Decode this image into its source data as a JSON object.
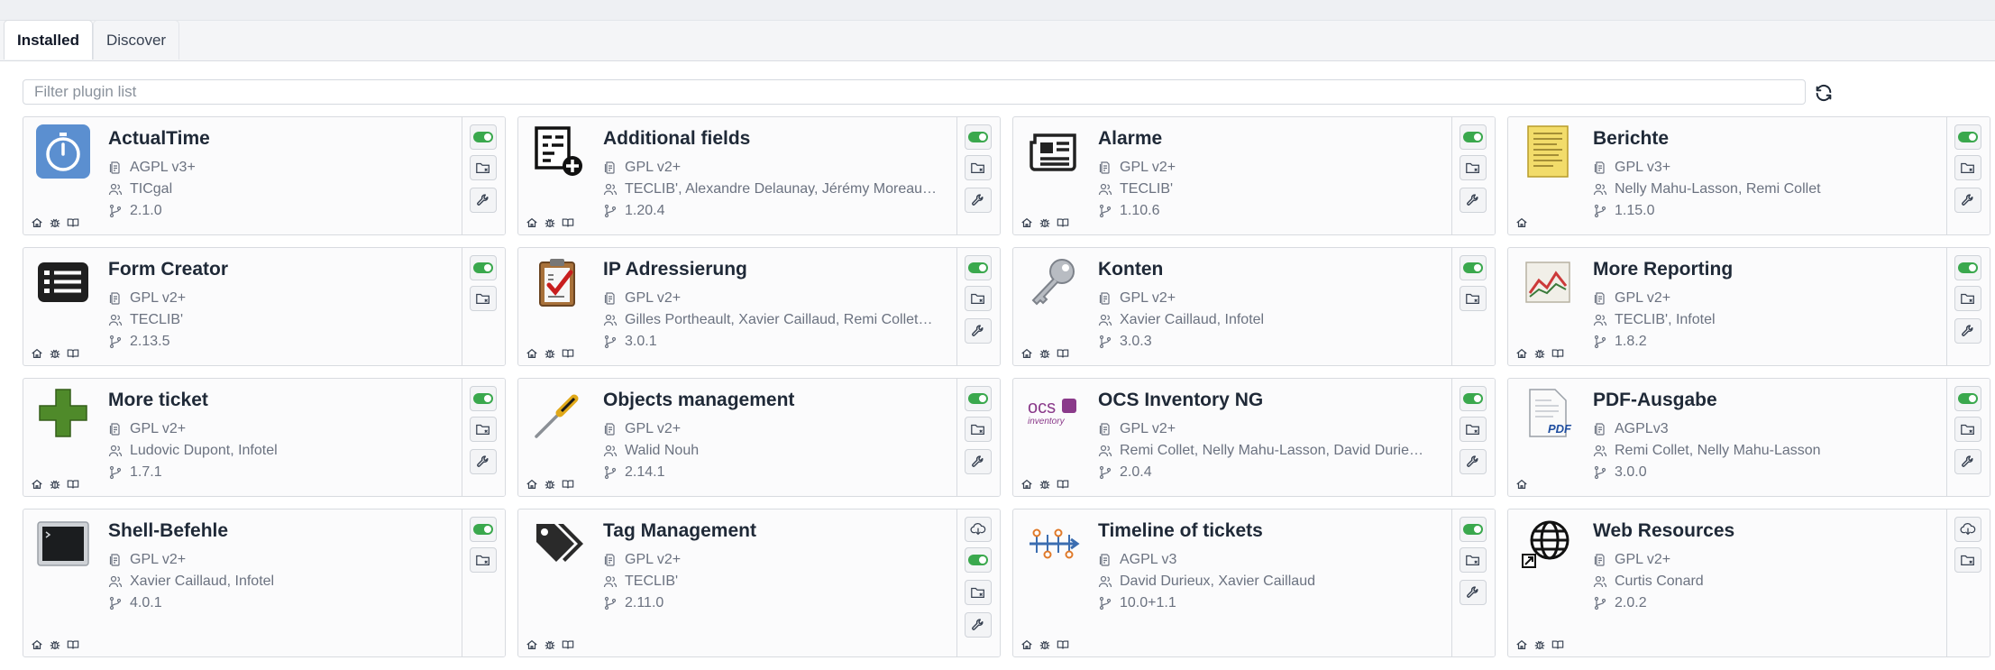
{
  "tabs": [
    {
      "label": "Installed",
      "active": true
    },
    {
      "label": "Discover",
      "active": false
    }
  ],
  "filter": {
    "placeholder": "Filter plugin list"
  },
  "plugins": [
    {
      "name": "ActualTime",
      "license": "AGPL v3+",
      "authors": "TICgal",
      "version": "2.1.0",
      "logo": "stopwatch-icon",
      "links": [
        "home",
        "bug",
        "book"
      ],
      "actions": [
        "toggle",
        "uninstall",
        "configure"
      ]
    },
    {
      "name": "Additional fields",
      "license": "GPL v2+",
      "authors": "TECLIB', Alexandre Delaunay, Jérémy Moreau…",
      "version": "1.20.4",
      "logo": "form-plus-icon",
      "links": [
        "home",
        "bug",
        "book"
      ],
      "actions": [
        "toggle",
        "uninstall",
        "configure"
      ]
    },
    {
      "name": "Alarme",
      "license": "GPL v2+",
      "authors": "TECLIB'",
      "version": "1.10.6",
      "logo": "newspaper-icon",
      "links": [
        "home",
        "bug",
        "book"
      ],
      "actions": [
        "toggle",
        "uninstall",
        "configure"
      ]
    },
    {
      "name": "Berichte",
      "license": "GPL v3+",
      "authors": "Nelly Mahu-Lasson, Remi Collet",
      "version": "1.15.0",
      "logo": "report-paper-icon",
      "links": [
        "home"
      ],
      "actions": [
        "toggle",
        "uninstall",
        "configure"
      ]
    },
    {
      "name": "Form Creator",
      "license": "GPL v2+",
      "authors": "TECLIB'",
      "version": "2.13.5",
      "logo": "list-form-icon",
      "links": [
        "home",
        "bug",
        "book"
      ],
      "actions": [
        "toggle",
        "uninstall"
      ]
    },
    {
      "name": "IP Adressierung",
      "license": "GPL v2+",
      "authors": "Gilles Portheault, Xavier Caillaud, Remi Collet…",
      "version": "3.0.1",
      "logo": "clipboard-check-icon",
      "links": [
        "home",
        "bug",
        "book"
      ],
      "actions": [
        "toggle",
        "uninstall",
        "configure"
      ]
    },
    {
      "name": "Konten",
      "license": "GPL v2+",
      "authors": "Xavier Caillaud, Infotel",
      "version": "3.0.3",
      "logo": "key-icon",
      "links": [
        "home",
        "bug",
        "book"
      ],
      "actions": [
        "toggle",
        "uninstall"
      ]
    },
    {
      "name": "More Reporting",
      "license": "GPL v2+",
      "authors": "TECLIB', Infotel",
      "version": "1.8.2",
      "logo": "line-chart-icon",
      "links": [
        "home",
        "bug",
        "book"
      ],
      "actions": [
        "toggle",
        "uninstall",
        "configure"
      ]
    },
    {
      "name": "More ticket",
      "license": "GPL v2+",
      "authors": "Ludovic Dupont, Infotel",
      "version": "1.7.1",
      "logo": "green-plus-icon",
      "links": [
        "home",
        "bug",
        "book"
      ],
      "actions": [
        "toggle",
        "uninstall",
        "configure"
      ]
    },
    {
      "name": "Objects management",
      "license": "GPL v2+",
      "authors": "Walid Nouh",
      "version": "2.14.1",
      "logo": "screwdriver-icon",
      "links": [
        "home",
        "bug",
        "book"
      ],
      "actions": [
        "toggle",
        "uninstall",
        "configure"
      ]
    },
    {
      "name": "OCS Inventory NG",
      "license": "GPL v2+",
      "authors": "Remi Collet, Nelly Mahu-Lasson, David Durie…",
      "version": "2.0.4",
      "logo": "ocs-logo",
      "logo_text": "ocs",
      "logo_subtext": "inventory",
      "links": [
        "home",
        "bug",
        "book"
      ],
      "actions": [
        "toggle",
        "uninstall",
        "configure"
      ]
    },
    {
      "name": "PDF-Ausgabe",
      "license": "AGPLv3",
      "authors": "Remi Collet, Nelly Mahu-Lasson",
      "version": "3.0.0",
      "logo": "pdf-document-icon",
      "logo_text": "PDF",
      "links": [
        "home"
      ],
      "actions": [
        "toggle",
        "uninstall",
        "configure"
      ]
    },
    {
      "name": "Shell-Befehle",
      "license": "GPL v2+",
      "authors": "Xavier Caillaud, Infotel",
      "version": "4.0.1",
      "logo": "terminal-icon",
      "links": [
        "home",
        "bug",
        "book"
      ],
      "actions": [
        "toggle",
        "uninstall"
      ]
    },
    {
      "name": "Tag Management",
      "license": "GPL v2+",
      "authors": "TECLIB'",
      "version": "2.11.0",
      "logo": "tags-icon",
      "links": [
        "home",
        "bug",
        "book"
      ],
      "actions": [
        "download",
        "toggle",
        "uninstall",
        "configure"
      ]
    },
    {
      "name": "Timeline of tickets",
      "license": "AGPL v3",
      "authors": "David Durieux, Xavier Caillaud",
      "version": "10.0+1.1",
      "logo": "timeline-icon",
      "links": [
        "home",
        "bug",
        "book"
      ],
      "actions": [
        "toggle",
        "uninstall",
        "configure"
      ]
    },
    {
      "name": "Web Resources",
      "license": "GPL v2+",
      "authors": "Curtis Conard",
      "version": "2.0.2",
      "logo": "globe-icon",
      "links": [
        "home",
        "bug",
        "book"
      ],
      "actions": [
        "download",
        "uninstall"
      ]
    }
  ],
  "colors": {
    "toggle_on": "#3aa84d",
    "accent": "#2f7fc4"
  }
}
